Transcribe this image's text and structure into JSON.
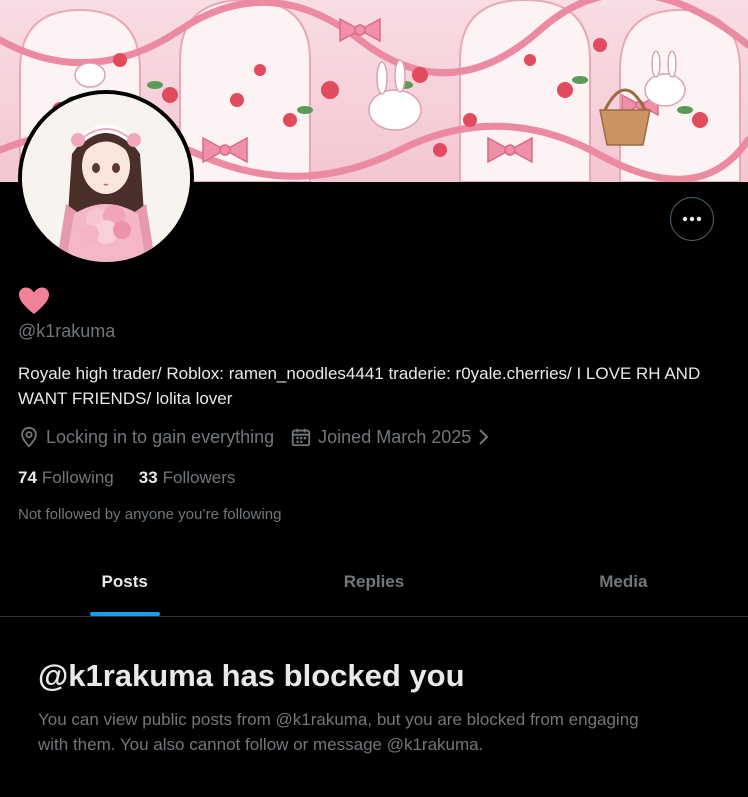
{
  "profile": {
    "handle": "@k1rakuma",
    "display_name_emoji": "heart",
    "bio": "Royale high trader/ Roblox: ramen_noodles4441 traderie: r0yale.cherries/ I LOVE RH AND WANT FRIENDS/ lolita lover",
    "location": "Locking in to gain everything",
    "joined": "Joined March 2025",
    "following_count": "74",
    "following_label": "Following",
    "followers_count": "33",
    "followers_label": "Followers",
    "followed_by_note": "Not followed by anyone you’re following"
  },
  "tabs": [
    {
      "label": "Posts",
      "active": true
    },
    {
      "label": "Replies",
      "active": false
    },
    {
      "label": "Media",
      "active": false
    }
  ],
  "blocked": {
    "title": "@k1rakuma has blocked you",
    "description": "You can view public posts from @k1rakuma, but you are blocked from engaging with them. You also cannot follow or message @k1rakuma."
  },
  "icons": {
    "more": "more-horizontal-icon",
    "location": "location-pin-icon",
    "calendar": "calendar-icon",
    "chevron": "chevron-right-icon",
    "heart": "heart-icon"
  },
  "colors": {
    "background": "#000000",
    "text_primary": "#e7e9ea",
    "text_secondary": "#71767b",
    "accent": "#1d9bf0",
    "divider": "#2f3336",
    "heart": "#f18196",
    "banner": "#f6d3dc"
  }
}
